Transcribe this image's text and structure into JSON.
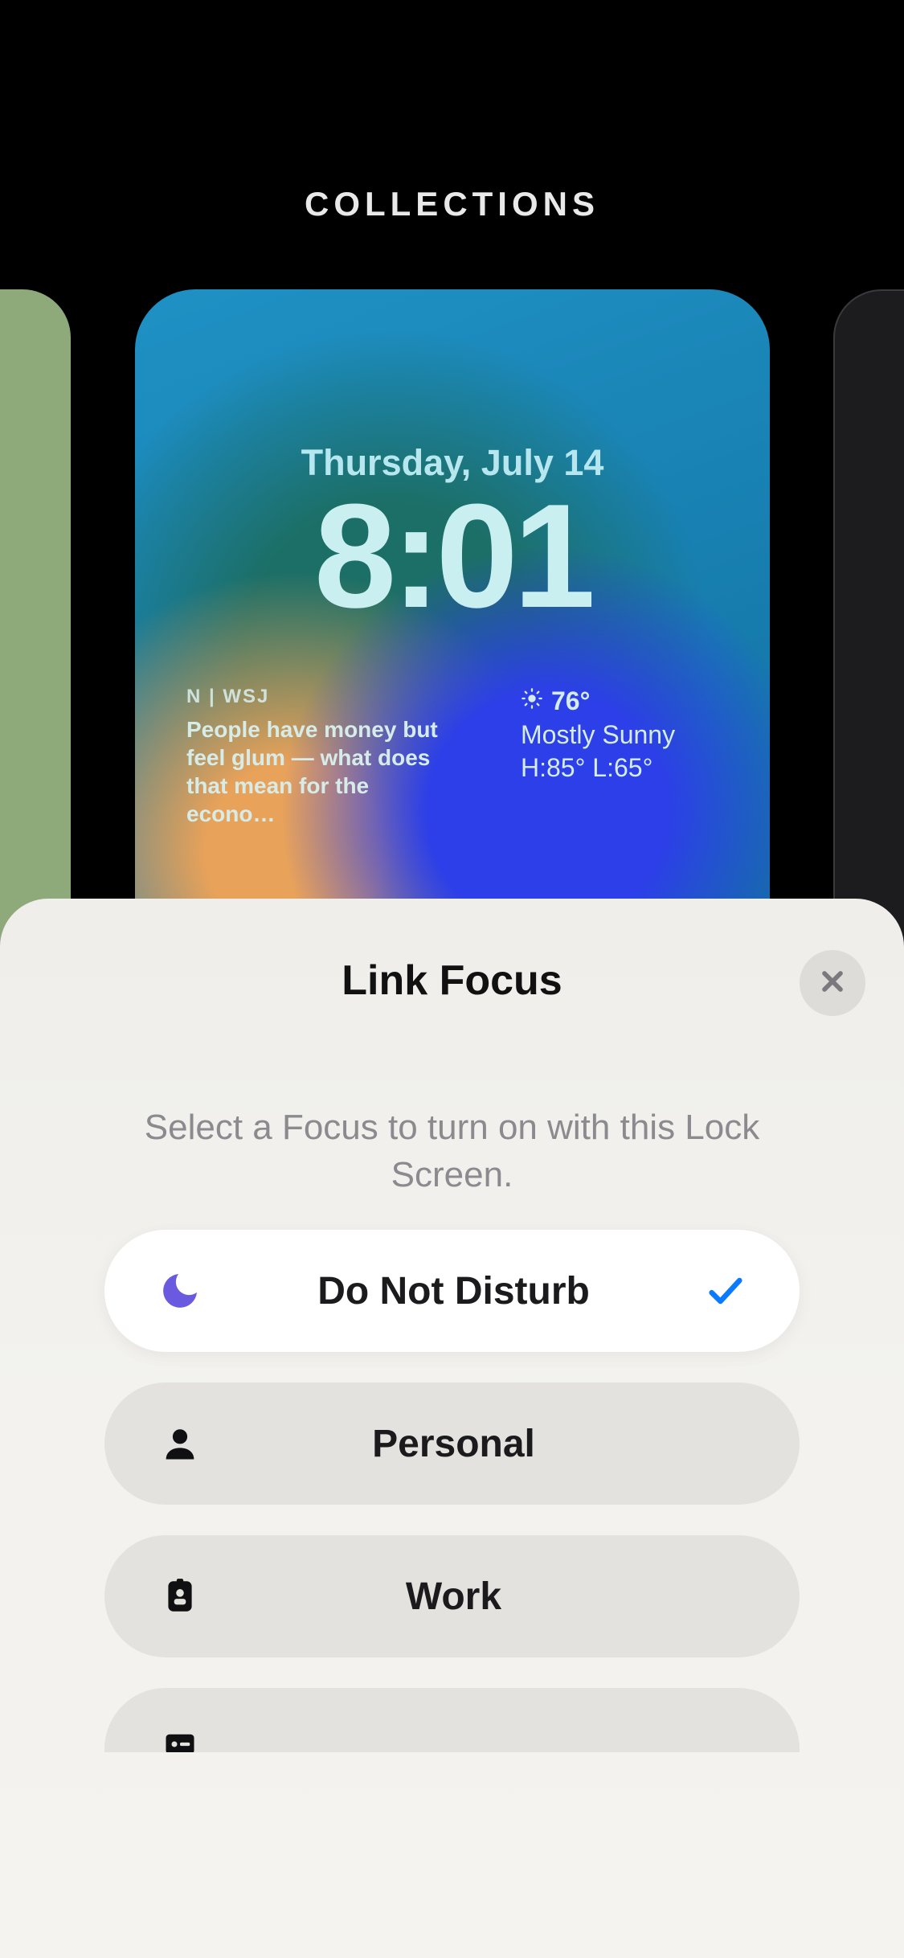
{
  "gallery": {
    "header": "COLLECTIONS"
  },
  "lockscreen": {
    "date": "Thursday, July 14",
    "time": "8:01",
    "news": {
      "source": "N | WSJ",
      "headline": "People have money but feel glum — what does that mean for the econo…"
    },
    "weather": {
      "temp": "76°",
      "condition": "Mostly Sunny",
      "hilo": "H:85° L:65°"
    }
  },
  "sheet": {
    "title": "Link Focus",
    "subtitle": "Select a Focus to turn on with this Lock Screen.",
    "options": [
      {
        "label": "Do Not Disturb",
        "icon": "moon",
        "selected": true
      },
      {
        "label": "Personal",
        "icon": "person",
        "selected": false
      },
      {
        "label": "Work",
        "icon": "badge",
        "selected": false
      },
      {
        "label": "",
        "icon": "card",
        "selected": false
      }
    ]
  }
}
